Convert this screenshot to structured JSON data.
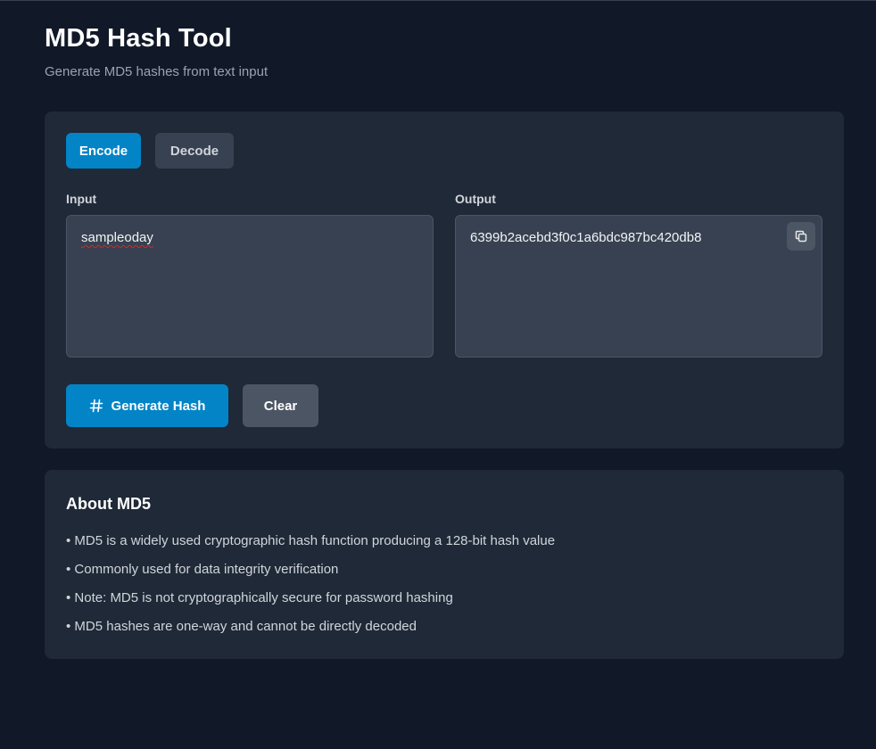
{
  "header": {
    "title": "MD5 Hash Tool",
    "subtitle": "Generate MD5 hashes from text input"
  },
  "modes": {
    "encode_label": "Encode",
    "decode_label": "Decode",
    "active": "Encode"
  },
  "input": {
    "label": "Input",
    "value": "sampleoday"
  },
  "output": {
    "label": "Output",
    "value": "6399b2acebd3f0c1a6bdc987bc420db8",
    "copy_icon": "copy-icon"
  },
  "actions": {
    "generate_label": "Generate Hash",
    "generate_icon": "hash-icon",
    "clear_label": "Clear"
  },
  "about": {
    "title": "About MD5",
    "items": [
      "• MD5 is a widely used cryptographic hash function producing a 128-bit hash value",
      "• Commonly used for data integrity verification",
      "• Note: MD5 is not cryptographically secure for password hashing",
      "• MD5 hashes are one-way and cannot be directly decoded"
    ]
  },
  "colors": {
    "background": "#111827",
    "card": "#1f2937",
    "field": "#374151",
    "accent": "#0284c7",
    "secondary_button": "#4b5563"
  }
}
